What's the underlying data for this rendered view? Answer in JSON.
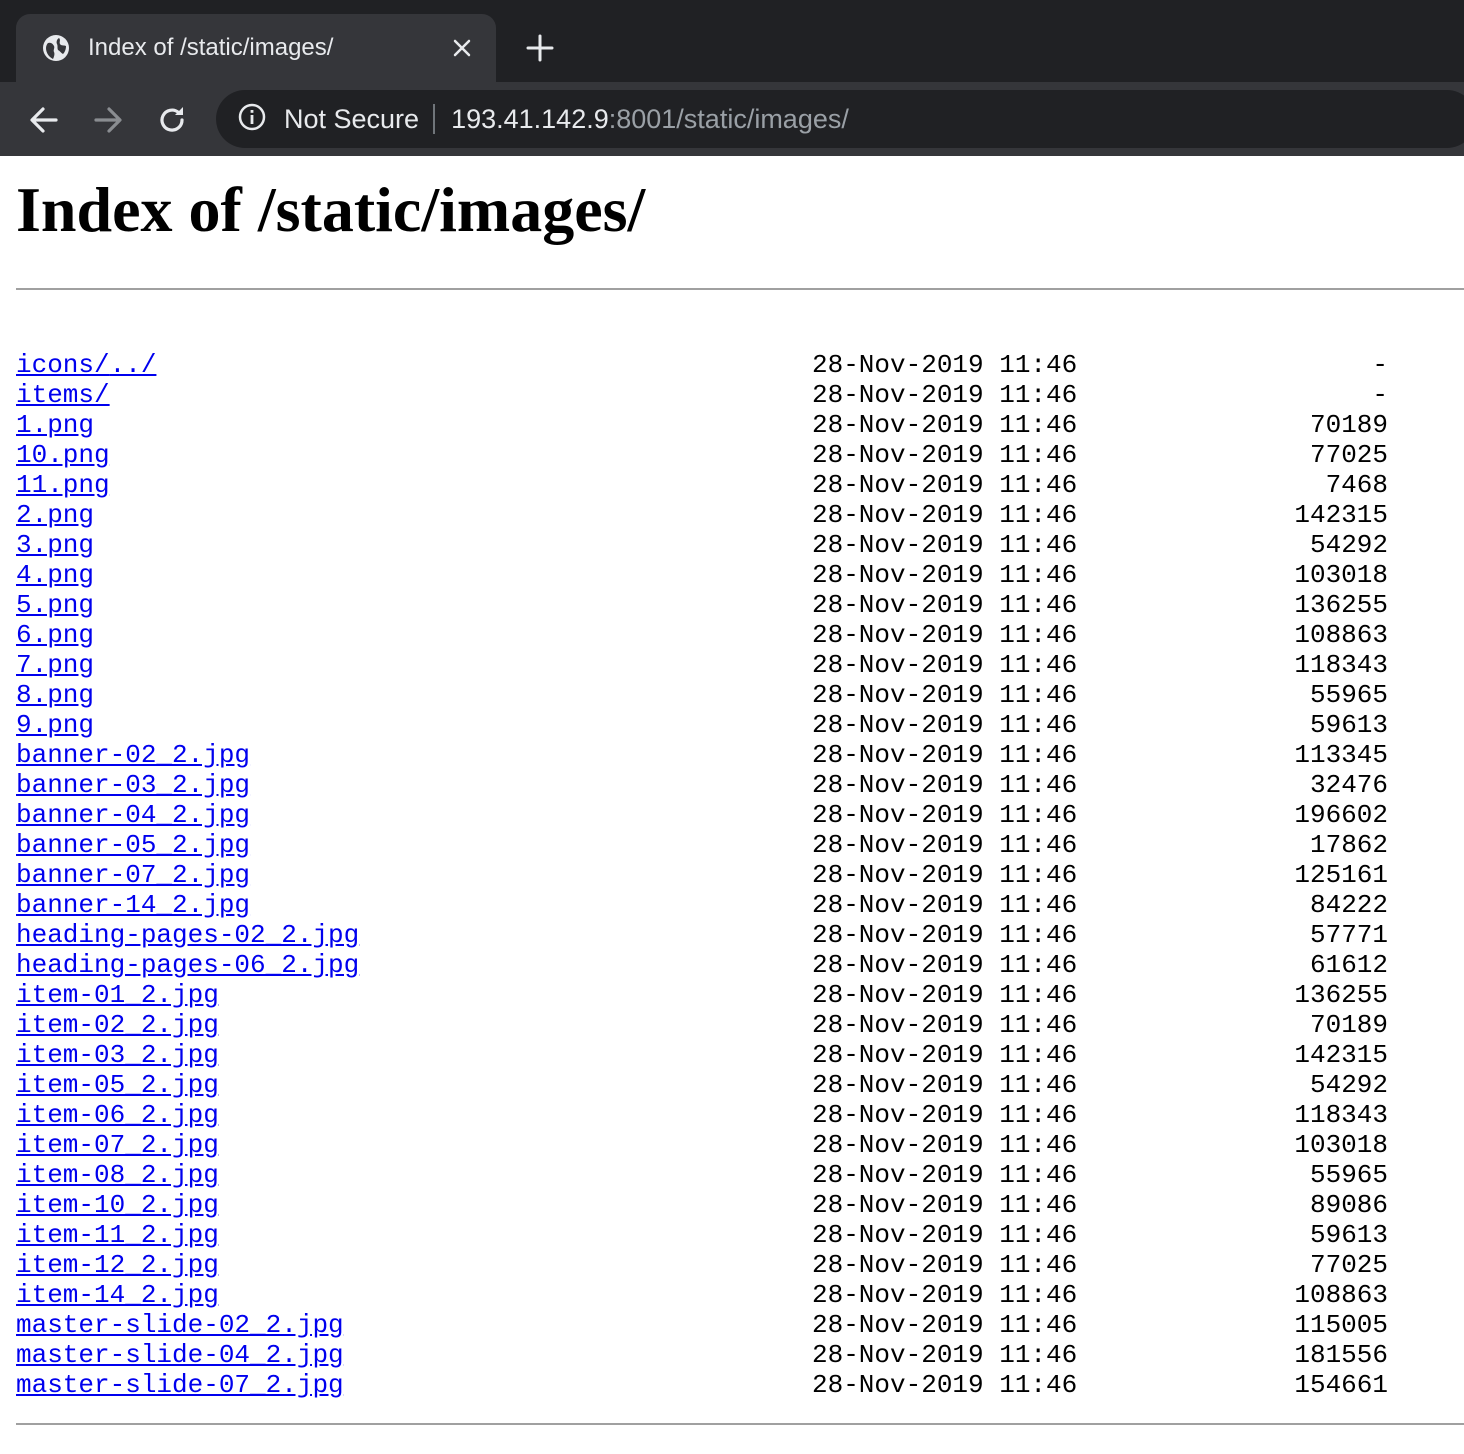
{
  "browser": {
    "tab_title": "Index of /static/images/",
    "tab_icon": "globe-icon",
    "close_icon": "close-icon",
    "new_tab_icon": "plus-icon",
    "back_icon": "arrow-left-icon",
    "forward_icon": "arrow-right-icon",
    "reload_icon": "reload-icon",
    "security_icon": "info-icon",
    "security_label": "Not Secure",
    "url_host": "193.41.142.9",
    "url_rest": ":8001/static/images/",
    "colors": {
      "tabstrip": "#202124",
      "toolbar": "#35363a",
      "omnibox": "#202124",
      "link": "#0000ee"
    }
  },
  "page": {
    "title": "Index of /static/images/",
    "parent_link": "../",
    "entries": [
      {
        "name": "icons/",
        "date": "28-Nov-2019 11:46",
        "size": "-"
      },
      {
        "name": "items/",
        "date": "28-Nov-2019 11:46",
        "size": "-"
      },
      {
        "name": "1.png",
        "date": "28-Nov-2019 11:46",
        "size": "70189"
      },
      {
        "name": "10.png",
        "date": "28-Nov-2019 11:46",
        "size": "77025"
      },
      {
        "name": "11.png",
        "date": "28-Nov-2019 11:46",
        "size": "7468"
      },
      {
        "name": "2.png",
        "date": "28-Nov-2019 11:46",
        "size": "142315"
      },
      {
        "name": "3.png",
        "date": "28-Nov-2019 11:46",
        "size": "54292"
      },
      {
        "name": "4.png",
        "date": "28-Nov-2019 11:46",
        "size": "103018"
      },
      {
        "name": "5.png",
        "date": "28-Nov-2019 11:46",
        "size": "136255"
      },
      {
        "name": "6.png",
        "date": "28-Nov-2019 11:46",
        "size": "108863"
      },
      {
        "name": "7.png",
        "date": "28-Nov-2019 11:46",
        "size": "118343"
      },
      {
        "name": "8.png",
        "date": "28-Nov-2019 11:46",
        "size": "55965"
      },
      {
        "name": "9.png",
        "date": "28-Nov-2019 11:46",
        "size": "59613"
      },
      {
        "name": "banner-02_2.jpg",
        "date": "28-Nov-2019 11:46",
        "size": "113345"
      },
      {
        "name": "banner-03_2.jpg",
        "date": "28-Nov-2019 11:46",
        "size": "32476"
      },
      {
        "name": "banner-04_2.jpg",
        "date": "28-Nov-2019 11:46",
        "size": "196602"
      },
      {
        "name": "banner-05_2.jpg",
        "date": "28-Nov-2019 11:46",
        "size": "17862"
      },
      {
        "name": "banner-07_2.jpg",
        "date": "28-Nov-2019 11:46",
        "size": "125161"
      },
      {
        "name": "banner-14_2.jpg",
        "date": "28-Nov-2019 11:46",
        "size": "84222"
      },
      {
        "name": "heading-pages-02_2.jpg",
        "date": "28-Nov-2019 11:46",
        "size": "57771"
      },
      {
        "name": "heading-pages-06_2.jpg",
        "date": "28-Nov-2019 11:46",
        "size": "61612"
      },
      {
        "name": "item-01_2.jpg",
        "date": "28-Nov-2019 11:46",
        "size": "136255"
      },
      {
        "name": "item-02_2.jpg",
        "date": "28-Nov-2019 11:46",
        "size": "70189"
      },
      {
        "name": "item-03_2.jpg",
        "date": "28-Nov-2019 11:46",
        "size": "142315"
      },
      {
        "name": "item-05_2.jpg",
        "date": "28-Nov-2019 11:46",
        "size": "54292"
      },
      {
        "name": "item-06_2.jpg",
        "date": "28-Nov-2019 11:46",
        "size": "118343"
      },
      {
        "name": "item-07_2.jpg",
        "date": "28-Nov-2019 11:46",
        "size": "103018"
      },
      {
        "name": "item-08_2.jpg",
        "date": "28-Nov-2019 11:46",
        "size": "55965"
      },
      {
        "name": "item-10_2.jpg",
        "date": "28-Nov-2019 11:46",
        "size": "89086"
      },
      {
        "name": "item-11_2.jpg",
        "date": "28-Nov-2019 11:46",
        "size": "59613"
      },
      {
        "name": "item-12_2.jpg",
        "date": "28-Nov-2019 11:46",
        "size": "77025"
      },
      {
        "name": "item-14_2.jpg",
        "date": "28-Nov-2019 11:46",
        "size": "108863"
      },
      {
        "name": "master-slide-02_2.jpg",
        "date": "28-Nov-2019 11:46",
        "size": "115005"
      },
      {
        "name": "master-slide-04_2.jpg",
        "date": "28-Nov-2019 11:46",
        "size": "181556"
      },
      {
        "name": "master-slide-07_2.jpg",
        "date": "28-Nov-2019 11:46",
        "size": "154661"
      }
    ]
  }
}
